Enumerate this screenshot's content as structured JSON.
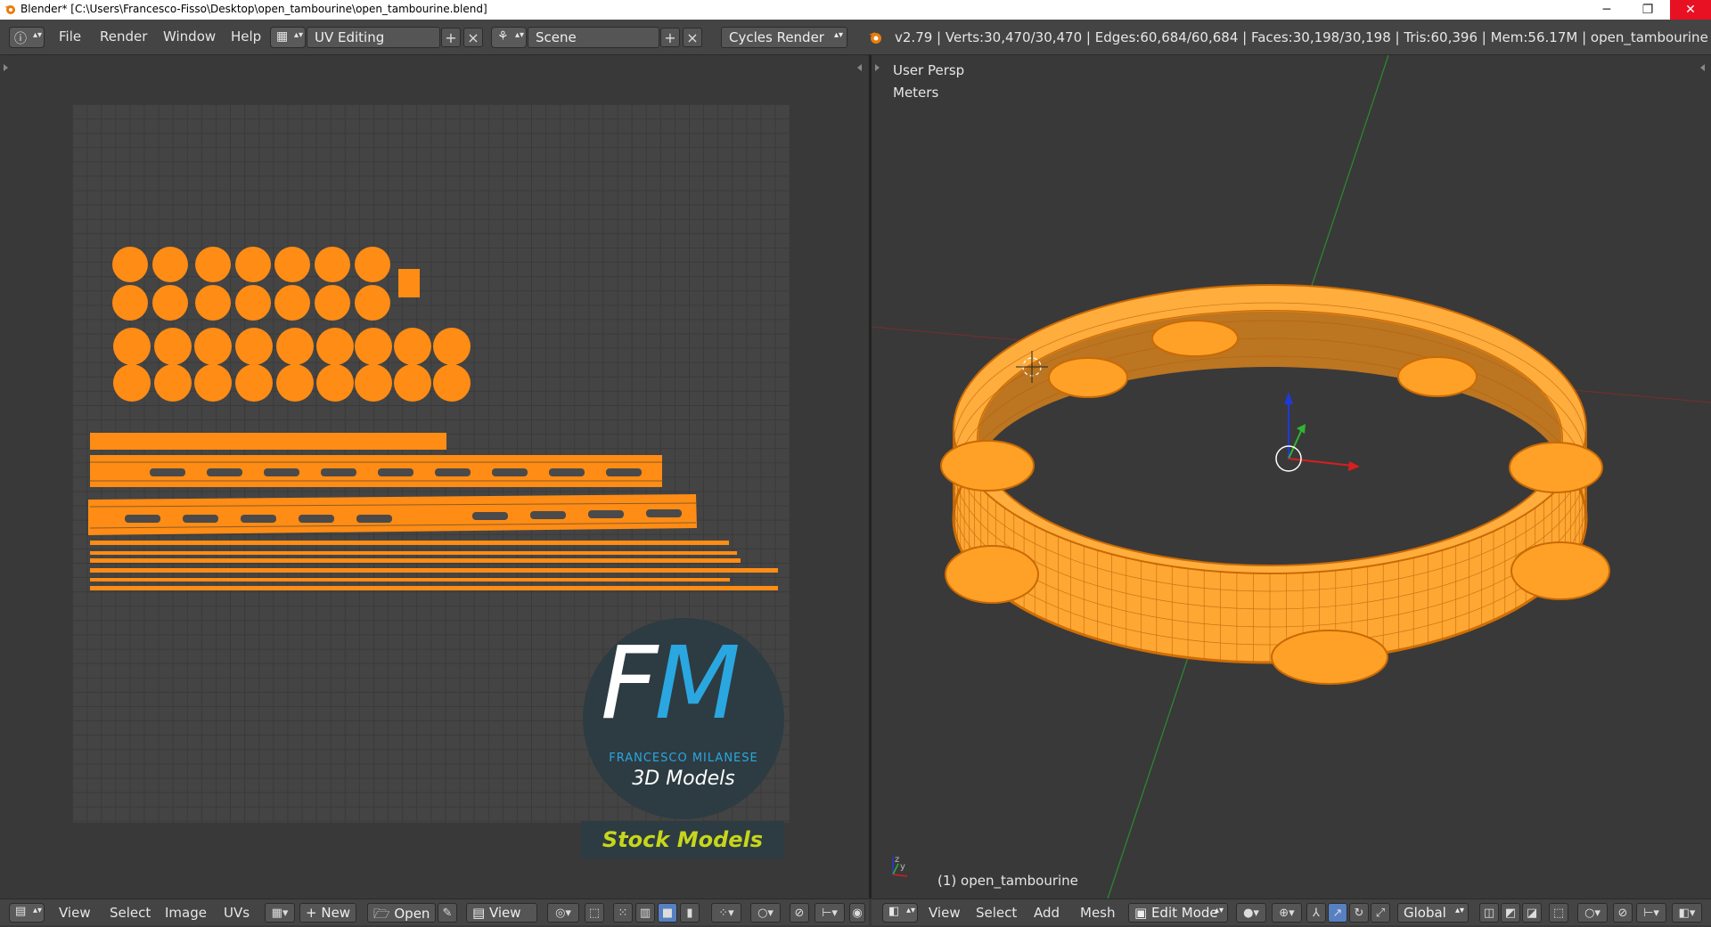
{
  "window": {
    "title": "Blender* [C:\\Users\\Francesco-Fisso\\Desktop\\open_tambourine\\open_tambourine.blend]",
    "minimize_glyph": "─",
    "restore_glyph": "❐",
    "close_glyph": "✕"
  },
  "header": {
    "menus": [
      "File",
      "Render",
      "Window",
      "Help"
    ],
    "screen_layout": "UV Editing",
    "scene": "Scene",
    "render_engine": "Cycles Render",
    "stats": "v2.79 | Verts:30,470/30,470 | Edges:60,684/60,684 | Faces:30,198/30,198 | Tris:60,396 | Mem:56.17M | open_tambourine"
  },
  "viewport": {
    "view_name": "User Persp",
    "units": "Meters",
    "object_label": "(1) open_tambourine"
  },
  "watermark": {
    "logo_letters": "FM",
    "brand": "FRANCESCO MILANESE",
    "subtitle": "3D Models",
    "tagline": "Stock Models"
  },
  "uv_bottom": {
    "menus": [
      "View",
      "Select",
      "Image",
      "UVs"
    ],
    "new_label": "New",
    "open_label": "Open",
    "view_label": "View"
  },
  "view3d_bottom": {
    "menus": [
      "View",
      "Select",
      "Add",
      "Mesh"
    ],
    "mode": "Edit Mode",
    "orientation": "Global"
  },
  "colors": {
    "selection": "#ff8c14",
    "background": "#393939",
    "header": "#444444",
    "accent_blue": "#5680c2"
  }
}
